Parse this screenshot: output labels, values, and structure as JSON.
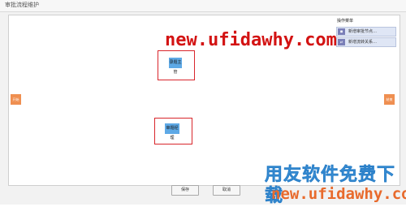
{
  "window": {
    "title": "审批流程维护"
  },
  "flow": {
    "start_label": "开始",
    "end_label": "结束",
    "node_top_label": "录题主管",
    "node_bottom_label": "审题经理"
  },
  "legend": {
    "title": "操作菜单",
    "items": [
      {
        "label": "新增审批节点…"
      },
      {
        "label": "新增流转关系…"
      }
    ]
  },
  "buttons": {
    "save": "保存",
    "cancel": "取消"
  },
  "watermarks": {
    "top_url": "new.ufidawhy.com",
    "brand_cn": "用友软件免费下载",
    "bottom_url": "new.ufidawhy.com"
  },
  "colors": {
    "node": "#5ea9e6",
    "start_end": "#ef8f51",
    "highlight": "#d9262c"
  }
}
